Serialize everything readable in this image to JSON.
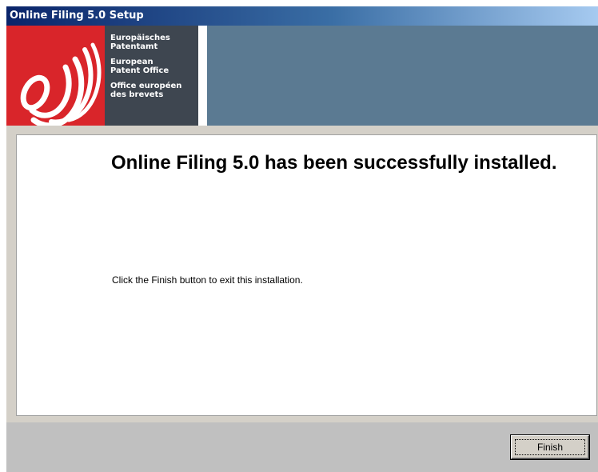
{
  "window": {
    "title": "Online Filing 5.0 Setup"
  },
  "banner": {
    "logo_icon": "epo-logo-icon",
    "org_names": [
      {
        "line1": "Europäisches",
        "line2": "Patentamt"
      },
      {
        "line1": "European",
        "line2": "Patent Office"
      },
      {
        "line1": "Office européen",
        "line2": "des brevets"
      }
    ],
    "colors": {
      "logo_red": "#d9252a",
      "name_panel": "#3e4650",
      "banner_blue": "#5b7a92"
    }
  },
  "content": {
    "headline": "Online Filing 5.0 has been successfully installed.",
    "instruction": "Click the Finish button to exit this installation."
  },
  "footer": {
    "finish_label": "Finish"
  }
}
